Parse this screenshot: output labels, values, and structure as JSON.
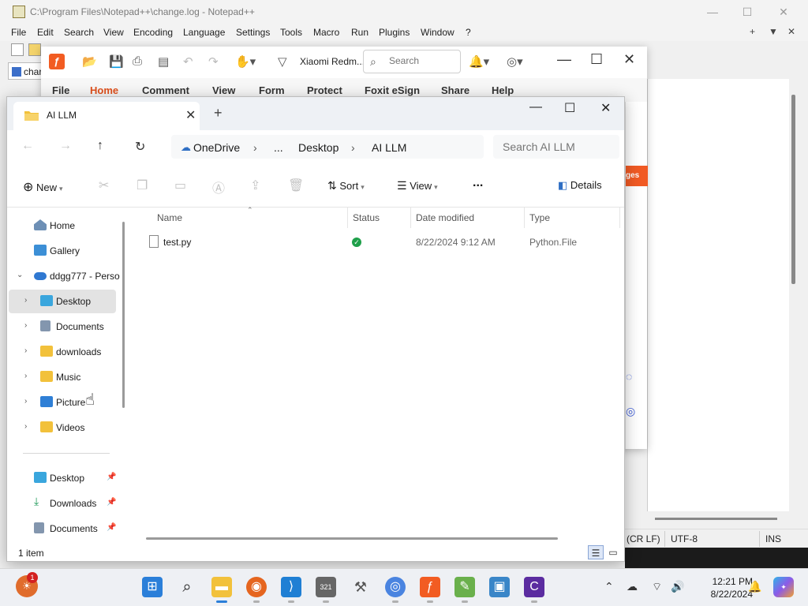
{
  "notepadpp": {
    "title": "C:\\Program Files\\Notepad++\\change.log - Notepad++",
    "menu": [
      "File",
      "Edit",
      "Search",
      "View",
      "Encoding",
      "Language",
      "Settings",
      "Tools",
      "Macro",
      "Run",
      "Plugins",
      "Window",
      "?"
    ],
    "menu_right": [
      "+",
      "▼",
      "✕"
    ],
    "tab_label": "char",
    "status": {
      "eol": "(CR LF)",
      "encoding": "UTF-8",
      "mode": "INS"
    }
  },
  "foxit": {
    "device_label": "Xiaomi Redm...",
    "search_placeholder": "Search",
    "ribbon_tabs": [
      "File",
      "Home",
      "Comment",
      "View",
      "Form",
      "Protect",
      "Foxit eSign",
      "Share",
      "Help"
    ],
    "active_tab": "Home",
    "side_label": "ges",
    "brand_color": "#f25c22"
  },
  "explorer": {
    "tab_title": "AI LLM",
    "breadcrumb": [
      "OneDrive",
      "...",
      "Desktop",
      "AI LLM"
    ],
    "search_placeholder": "Search AI LLM",
    "commands": {
      "new": "New",
      "sort": "Sort",
      "view": "View",
      "more": "...",
      "details": "Details"
    },
    "nav_items": [
      {
        "label": "Home",
        "icon": "home-icon"
      },
      {
        "label": "Gallery",
        "icon": "gallery-icon"
      },
      {
        "label": "ddgg777 - Perso",
        "icon": "onedrive-icon"
      },
      {
        "label": "Desktop",
        "icon": "desktop-folder-icon"
      },
      {
        "label": "Documents",
        "icon": "documents-folder-icon"
      },
      {
        "label": "downloads",
        "icon": "folder-icon"
      },
      {
        "label": "Music",
        "icon": "folder-icon"
      },
      {
        "label": "Picture",
        "icon": "pictures-folder-icon"
      },
      {
        "label": "Videos",
        "icon": "folder-icon"
      },
      {
        "label": "Desktop",
        "icon": "desktop-folder-icon"
      },
      {
        "label": "Downloads",
        "icon": "download-icon"
      },
      {
        "label": "Documents",
        "icon": "documents-folder-icon"
      }
    ],
    "columns": [
      "Name",
      "Status",
      "Date modified",
      "Type"
    ],
    "files": [
      {
        "name": "test.py",
        "status": "synced",
        "date": "8/22/2024 9:12 AM",
        "type": "Python.File"
      }
    ],
    "item_count": "1 item",
    "folder_color": "#f2c13b",
    "synced_color": "#1fa04a"
  },
  "taskbar": {
    "time": "12:21 PM",
    "date": "8/22/2024",
    "weather_badge": "1",
    "calendar_text": "321"
  }
}
